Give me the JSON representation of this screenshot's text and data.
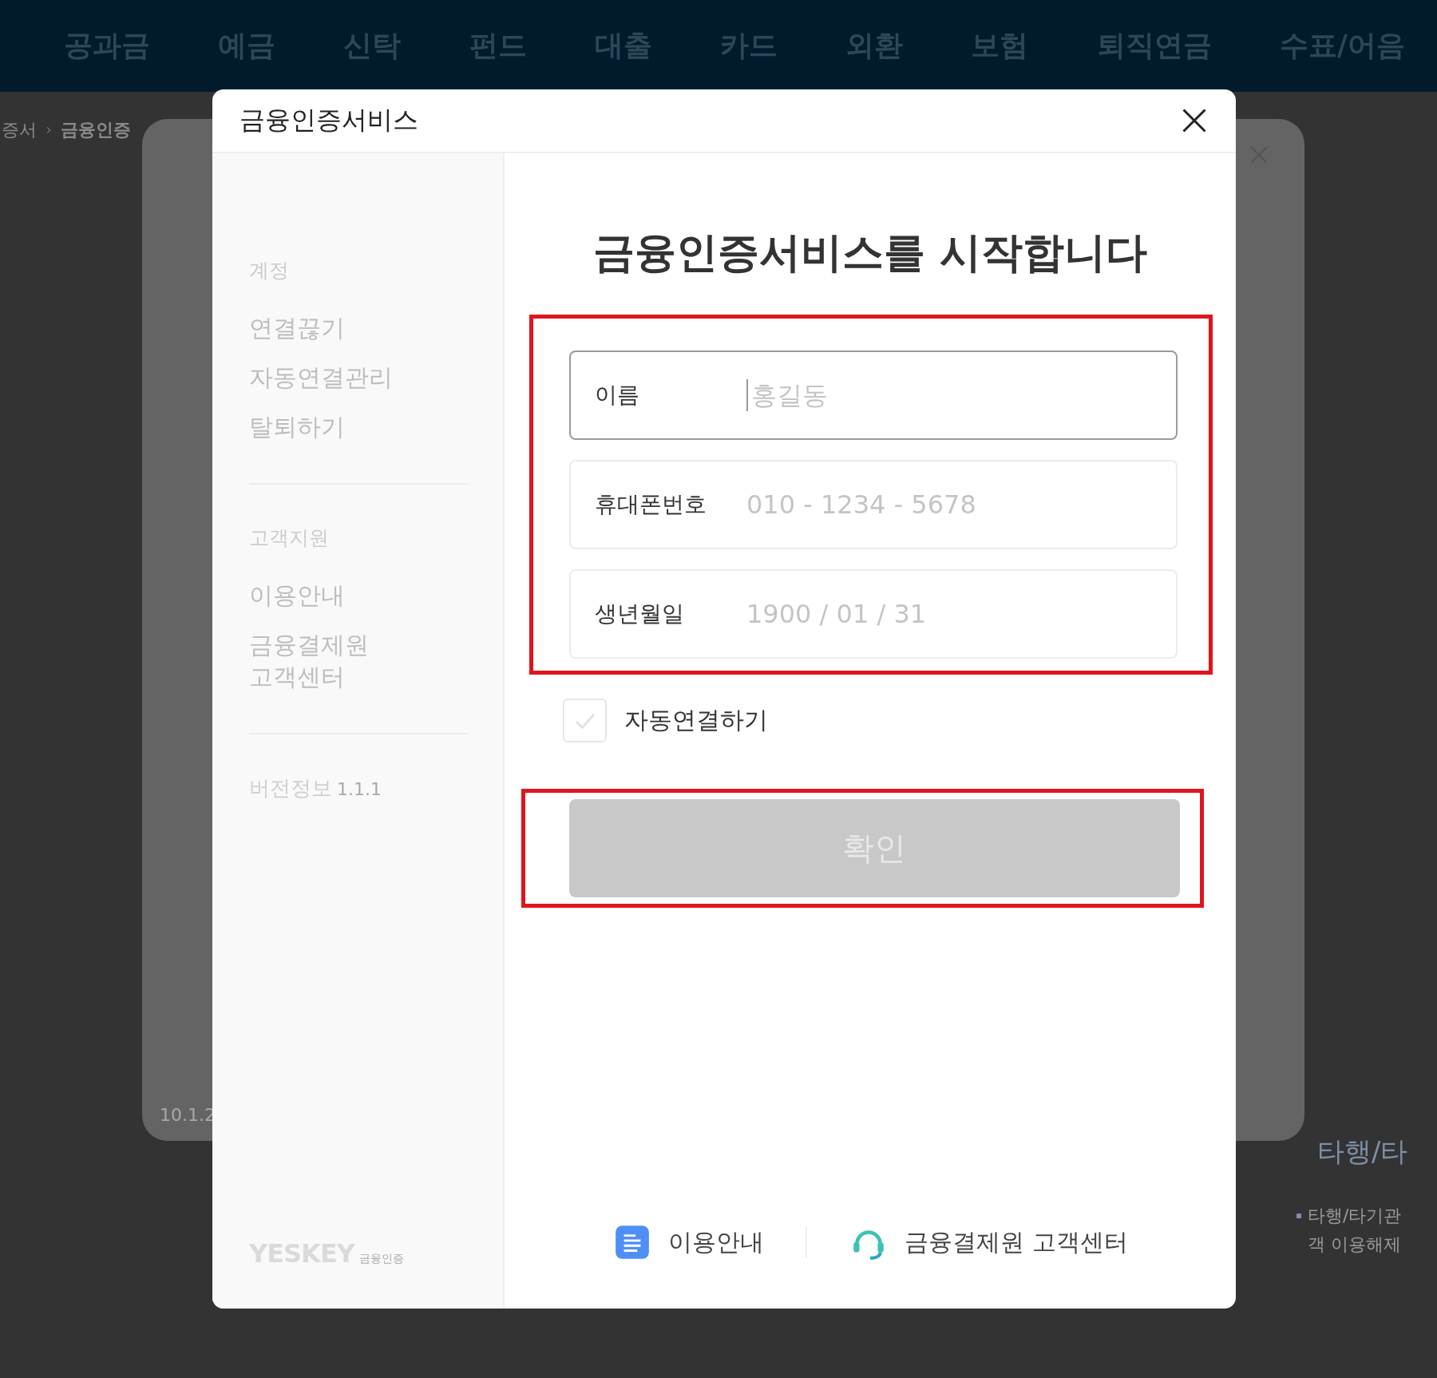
{
  "nav": {
    "items": [
      "공과금",
      "예금",
      "신탁",
      "펀드",
      "대출",
      "카드",
      "외환",
      "보험",
      "퇴직연금",
      "수표/어음"
    ]
  },
  "breadcrumb": {
    "items": [
      "증서",
      "금융인증"
    ]
  },
  "background_dialog": {
    "version": "10.1.2"
  },
  "background_aside": {
    "heading": "타행/타",
    "lines": [
      "타행/타기관",
      "객 이용해제"
    ]
  },
  "dialog": {
    "title": "금융인증서비스",
    "sidebar": {
      "sections": [
        {
          "label": "계정",
          "items": [
            "연결끊기",
            "자동연결관리",
            "탈퇴하기"
          ]
        },
        {
          "label": "고객지원",
          "items": [
            "이용안내",
            "금융결제원\n고객센터"
          ]
        }
      ],
      "version_label": "버전정보",
      "version": "1.1.1",
      "logo": "YESKEY",
      "logo_caption": "금융인증"
    },
    "heading": "금융인증서비스를 시작합니다",
    "form": {
      "highlighted": true,
      "fields": [
        {
          "label": "이름",
          "placeholder": "홍길동",
          "focused": true
        },
        {
          "label": "휴대폰번호",
          "placeholder": "010 - 1234 - 5678",
          "focused": false
        },
        {
          "label": "생년월일",
          "placeholder": "1900 / 01 / 31",
          "focused": false
        }
      ]
    },
    "auto_connect": {
      "label": "자동연결하기",
      "checked": false
    },
    "confirm_button": {
      "label": "확인",
      "disabled": true,
      "highlighted": true
    },
    "footer_links": [
      {
        "kind": "guide",
        "label": "이용안내"
      },
      {
        "kind": "support",
        "label": "금융결제원 고객센터"
      }
    ]
  }
}
